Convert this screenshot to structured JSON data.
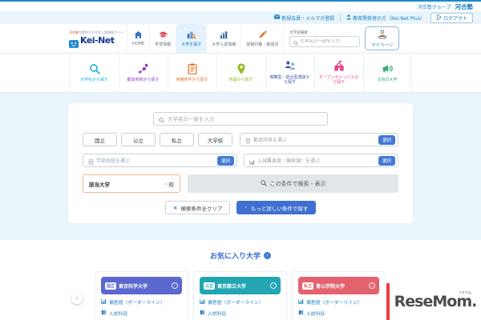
{
  "brand_bar": {
    "group_text": "河合塾グループ",
    "brand_logo": "河合塾"
  },
  "utility": {
    "register": "新規会員・メルマガ登録",
    "educators": "教育関係者の方（Kei-Net Plus）",
    "logout": "ログアウト"
  },
  "header": {
    "tagline_brand": "河合塾",
    "tagline_rest": "が提供する大学入試情報サイト",
    "logo": "Kei-Net",
    "nav": [
      {
        "label": "HOME",
        "icon": "home-icon"
      },
      {
        "label": "学習情報",
        "icon": "grad-cap-icon"
      },
      {
        "label": "大学を探す",
        "icon": "university-search-icon",
        "active": true
      },
      {
        "label": "大学入試情報",
        "icon": "bar-chart-icon"
      },
      {
        "label": "受験対策・勉強法",
        "icon": "pen-icon"
      }
    ],
    "search_label": "大学名検索",
    "search_placeholder": "大学名の一部を入力",
    "mypage": "マイページ"
  },
  "categories": [
    {
      "label": "大学名から探す",
      "icon": "magnifier-icon",
      "color": "#19b3d4"
    },
    {
      "label": "都道府県から探す",
      "icon": "japan-map-icon",
      "color": "#8b3fc6"
    },
    {
      "label": "各種条件から探す",
      "icon": "clipboard-icon",
      "color": "#e8772e"
    },
    {
      "label": "地図から探す",
      "icon": "map-pin-icon",
      "color": "#93bb22"
    },
    {
      "label": "推薦型・総合型選抜から探す",
      "icon": "people-icon",
      "color": "#3a56a8"
    },
    {
      "label": "オープンキャンパスから探す",
      "icon": "school-icon",
      "color": "#e84a8a"
    },
    {
      "label": "注目の大学",
      "icon": "megaphone-icon",
      "color": "#2fae71"
    }
  ],
  "search_panel": {
    "main_placeholder": "大学名の一部を入力",
    "type_buttons": [
      "国立",
      "公立",
      "私立",
      "大学校"
    ],
    "prefecture_placeholder": "都道府県を選ぶ",
    "faculty_placeholder": "学部系統を選ぶ",
    "difficulty_placeholder": "入試難易度（偏差値）を選ぶ",
    "select_label": "選択",
    "matched_label": "該当大学",
    "matched_count": "-",
    "matched_unit": "校",
    "search_button": "この条件で検索・表示",
    "clear_button": "検索条件全クリア",
    "detail_button": "もっと詳しい条件で探す"
  },
  "favorites": {
    "title": "お気に入り大学",
    "link_border": "偏差値（ボーダーライン）",
    "link_subject": "入試科目",
    "cards": [
      {
        "type": "国立",
        "name": "東京科学大学",
        "color": "#5a68d0"
      },
      {
        "type": "公立",
        "name": "東京都立大学",
        "color": "#23a6b2"
      },
      {
        "type": "私立",
        "name": "青山学院大学",
        "color": "#e2636e"
      }
    ]
  },
  "watermark": {
    "text": "ReseMom.",
    "ruby": "リセマム"
  },
  "icons": {
    "chevron_right": "›",
    "chevron_left": "‹",
    "close": "×"
  },
  "colors": {
    "accent_blue": "#1a7fc4",
    "button_blue": "#3f6fd0",
    "light_blue_bg": "#e9f4fb",
    "select_blue": "#4479d6",
    "matched_orange": "#e87b2e",
    "watermark_red": "#ee3a3f"
  }
}
